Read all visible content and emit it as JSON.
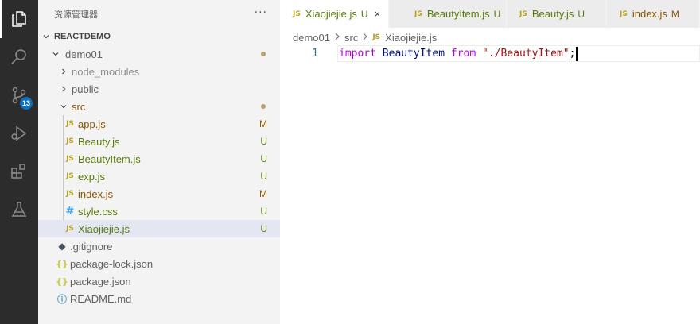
{
  "colors": {
    "activity_bar": "#2c2c2c",
    "sidebar_bg": "#f3f3f3",
    "selected_row": "#e4e6f1",
    "modified": "#895503",
    "untracked": "#587c0c",
    "badge": "#0e70c0",
    "keyword": "#af00db",
    "identifier": "#001080",
    "string": "#a31515"
  },
  "activity_bar": {
    "items": [
      {
        "icon": "explorer-icon"
      },
      {
        "icon": "search-icon"
      },
      {
        "icon": "source-control-icon",
        "badge": "13"
      },
      {
        "icon": "run-debug-icon"
      },
      {
        "icon": "extensions-icon"
      },
      {
        "icon": "testing-icon"
      }
    ]
  },
  "sidebar": {
    "title": "资源管理器",
    "more": "···",
    "tree": [
      {
        "label": "REACTDEMO",
        "kind": "root"
      },
      {
        "label": "demo01",
        "kind": "folder",
        "status": "dot"
      },
      {
        "label": "node_modules",
        "kind": "folder"
      },
      {
        "label": "public",
        "kind": "folder"
      },
      {
        "label": "src",
        "kind": "folder",
        "status": "dot"
      },
      {
        "label": "app.js",
        "icon": "JS",
        "status": "M"
      },
      {
        "label": "Beauty.js",
        "icon": "JS",
        "status": "U"
      },
      {
        "label": "BeautyItem.js",
        "icon": "JS",
        "status": "U"
      },
      {
        "label": "exp.js",
        "icon": "JS",
        "status": "U"
      },
      {
        "label": "index.js",
        "icon": "JS",
        "status": "M"
      },
      {
        "label": "style.css",
        "icon": "#",
        "status": "U"
      },
      {
        "label": "Xiaojiejie.js",
        "icon": "JS",
        "status": "U"
      },
      {
        "label": ".gitignore",
        "icon": "◆"
      },
      {
        "label": "package-lock.json",
        "icon": "{}"
      },
      {
        "label": "package.json",
        "icon": "{}"
      },
      {
        "label": "README.md",
        "icon": "ⓘ"
      }
    ]
  },
  "tabs": [
    {
      "js": "JS",
      "name": "Xiaojiejie.js",
      "status": "U",
      "close": "×",
      "active": true
    },
    {
      "js": "JS",
      "name": "BeautyItem.js",
      "status": "U"
    },
    {
      "js": "JS",
      "name": "Beauty.js",
      "status": "U"
    },
    {
      "js": "JS",
      "name": "index.js",
      "status": "M"
    }
  ],
  "breadcrumb": {
    "parts": [
      "demo01",
      "src"
    ],
    "file_icon": "JS",
    "file": "Xiaojiejie.js"
  },
  "editor": {
    "line_number": "1",
    "tokens": {
      "kw1": "import",
      "id": " BeautyItem ",
      "kw2": "from",
      "sp": " ",
      "str": "\"./BeautyItem\"",
      "punc": ";"
    }
  }
}
